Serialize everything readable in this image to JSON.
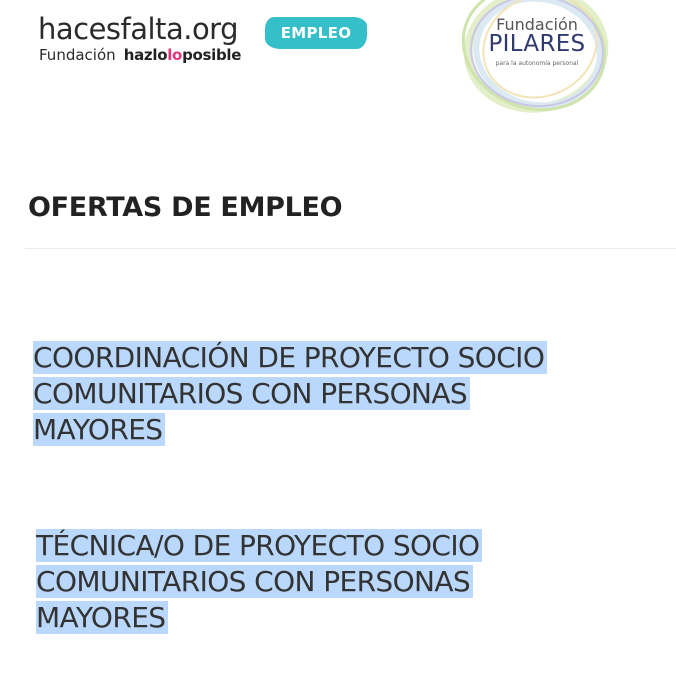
{
  "header": {
    "brand_name": "hacesfalta.org",
    "brand_foundation": "Fundación",
    "brand_hazlo_a": "hazlo",
    "brand_hazlo_b": "lo",
    "brand_hazlo_c": "posible",
    "badge": "EMPLEO",
    "partner": {
      "top": "Fundación",
      "name": "PILARES",
      "tagline": "para la autonomía personal"
    }
  },
  "section": {
    "title": "OFERTAS DE EMPLEO"
  },
  "offers": [
    {
      "lines": [
        "COORDINACIÓN DE PROYECTO SOCIO",
        "COMUNITARIOS CON PERSONAS",
        "MAYORES"
      ]
    },
    {
      "lines": [
        "TÉCNICA/O DE PROYECTO SOCIO",
        "COMUNITARIOS CON PERSONAS",
        "MAYORES"
      ]
    }
  ],
  "colors": {
    "badge": "#35bfc8",
    "accent_pink": "#e6337a",
    "selection": "#b9d8fc",
    "partner_navy": "#2f3a6e"
  }
}
